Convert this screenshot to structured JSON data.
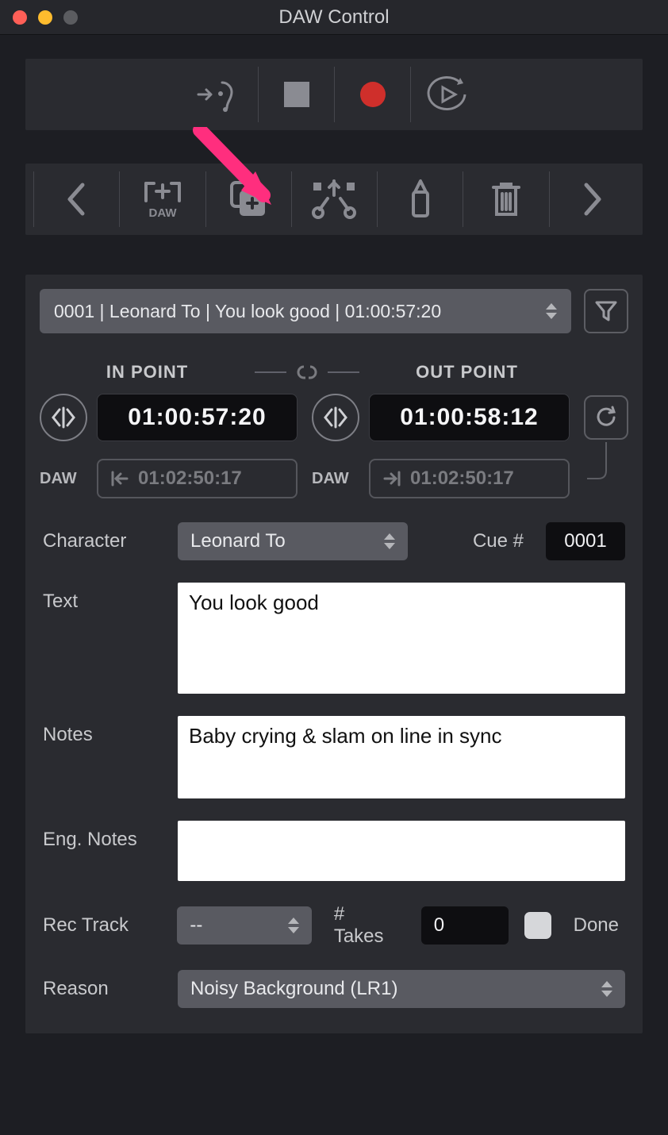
{
  "window": {
    "title": "DAW Control"
  },
  "transport": {
    "listen": "listen-icon",
    "stop": "stop-icon",
    "record": "record-icon",
    "loop": "loop-play-icon"
  },
  "editbar": {
    "prev": "chevron-left-icon",
    "add_daw": "add-to-daw-icon",
    "duplicate": "duplicate-icon",
    "split": "split-cut-icon",
    "glue": "glue-icon",
    "delete": "trash-icon",
    "next": "chevron-right-icon"
  },
  "cue_select": {
    "label": "0001 | Leonard To | You look good | 01:00:57:20"
  },
  "points": {
    "in_label": "IN POINT",
    "out_label": "OUT POINT",
    "in_tc": "01:00:57:20",
    "out_tc": "01:00:58:12",
    "daw_label": "DAW",
    "daw_in": "01:02:50:17",
    "daw_out": "01:02:50:17"
  },
  "form": {
    "character_label": "Character",
    "character_value": "Leonard To",
    "cue_num_label": "Cue #",
    "cue_num_value": "0001",
    "text_label": "Text",
    "text_value": "You look good",
    "notes_label": "Notes",
    "notes_value": "Baby crying & slam on line in sync",
    "eng_notes_label": "Eng. Notes",
    "eng_notes_value": "",
    "rec_track_label": "Rec Track",
    "rec_track_value": "--",
    "takes_label": "# Takes",
    "takes_value": "0",
    "done_label": "Done",
    "reason_label": "Reason",
    "reason_value": "Noisy Background (LR1)"
  }
}
